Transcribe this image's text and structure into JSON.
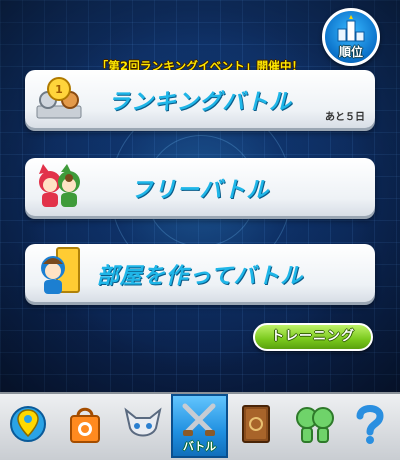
{
  "rank_button": {
    "label": "順位",
    "icon": "trophy-ranking-icon"
  },
  "event_banner": "「第2回ランキングイベント」開催中！",
  "menu": {
    "ranking_battle": {
      "label": "ランキングバトル",
      "remaining": "あと５日",
      "icon": "medal-podium-icon"
    },
    "free_battle": {
      "label": "フリーバトル",
      "icon": "two-characters-icon"
    },
    "room_battle": {
      "label": "部屋を作ってバトル",
      "icon": "character-door-icon"
    }
  },
  "training_button": {
    "label": "トレーニング"
  },
  "tabbar": {
    "active_tab": "battle",
    "tabs": [
      {
        "id": "home",
        "label": "",
        "icon": "map-pin-icon"
      },
      {
        "id": "shop",
        "label": "",
        "icon": "shopping-bag-icon"
      },
      {
        "id": "monsters",
        "label": "",
        "icon": "monster-icon"
      },
      {
        "id": "battle",
        "label": "バトル",
        "icon": "crossed-swords-icon"
      },
      {
        "id": "book",
        "label": "",
        "icon": "book-icon"
      },
      {
        "id": "friends",
        "label": "",
        "icon": "friends-icon"
      },
      {
        "id": "other",
        "label": "",
        "icon": "question-icon"
      }
    ]
  },
  "colors": {
    "accent": "#1fb6e8",
    "banner": "#ffe800",
    "training": "#7ac91d",
    "active_tab": "#1f8fe0"
  }
}
